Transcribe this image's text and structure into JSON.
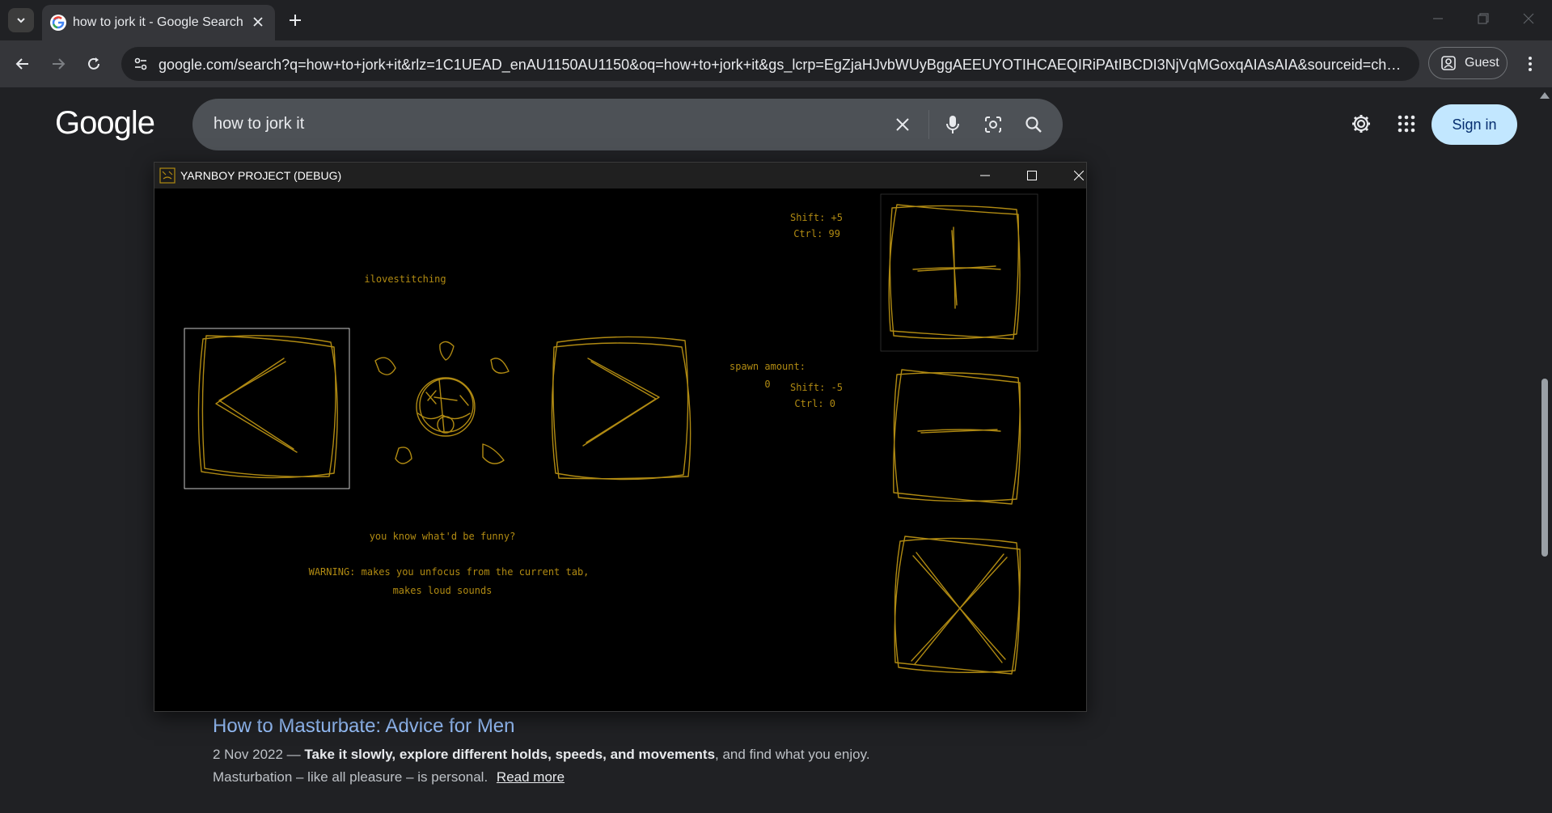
{
  "browser": {
    "tab_title": "how to jork it - Google Search",
    "url": "google.com/search?q=how+to+jork+it&rlz=1C1UEAD_enAU1150AU1150&oq=how+to+jork+it&gs_lcrp=EgZjaHJvbWUyBggAEEUYOTIHCAEQIRiPAtIBCDI3NjVqMGoxqAIAsAIA&sourceid=chrome&i...",
    "profile_label": "Guest"
  },
  "google": {
    "logo": "Google",
    "query": "how to jork it",
    "signin_label": "Sign in"
  },
  "result": {
    "title": "How to Masturbate: Advice for Men",
    "date": "2 Nov 2022 — ",
    "snippet_bold": "Take it slowly, explore different holds, speeds, and movements",
    "snippet_rest": ", and find what you enjoy. Masturbation – like all pleasure – is personal.",
    "read_more": "Read more"
  },
  "game": {
    "window_title": "YARNBOY PROJECT (DEBUG)",
    "label_top": "ilovestitching",
    "plus_shift": "Shift: +5",
    "plus_ctrl": "Ctrl: 99",
    "spawn_label": "spawn amount:",
    "spawn_value": "0",
    "minus_shift": "Shift: -5",
    "minus_ctrl": "Ctrl: 0",
    "funny": "you know what'd be funny?",
    "warning_1": "WARNING: makes you unfocus from the current tab,",
    "warning_2": "makes loud sounds",
    "accent_color": "#b08a12"
  }
}
